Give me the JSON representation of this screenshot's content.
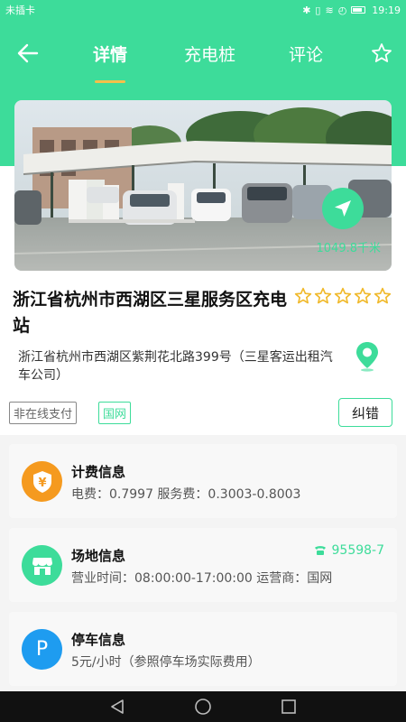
{
  "status_bar": {
    "carrier": "未插卡",
    "time": "19:19"
  },
  "tabs": [
    {
      "label": "详情",
      "active": true
    },
    {
      "label": "充电桩",
      "active": false
    },
    {
      "label": "评论",
      "active": false
    }
  ],
  "photo": {
    "distance": "1049.8千米"
  },
  "station": {
    "name": "浙江省杭州市西湖区三星服务区充电站",
    "address": "浙江省杭州市西湖区紫荆花北路399号（三星客运出租汽车公司）",
    "rating_stars": 5
  },
  "tags": {
    "offline_payment": "非在线支付",
    "grid": "国网"
  },
  "correct_button": "纠错",
  "cards": {
    "fee": {
      "title": "计费信息",
      "desc": "电费：0.7997  服务费：0.3003-0.8003"
    },
    "site": {
      "title": "场地信息",
      "desc": "营业时间：08:00:00-17:00:00  运营商：国网",
      "phone": "95598-7"
    },
    "parking": {
      "title": "停车信息",
      "desc": "5元/小时（参照停车场实际费用）",
      "icon_letter": "P"
    }
  },
  "colors": {
    "accent": "#3ddc9a",
    "fee_icon": "#f59a1f",
    "parking_icon": "#1e9cf0",
    "tab_indicator": "#f5c04a"
  }
}
